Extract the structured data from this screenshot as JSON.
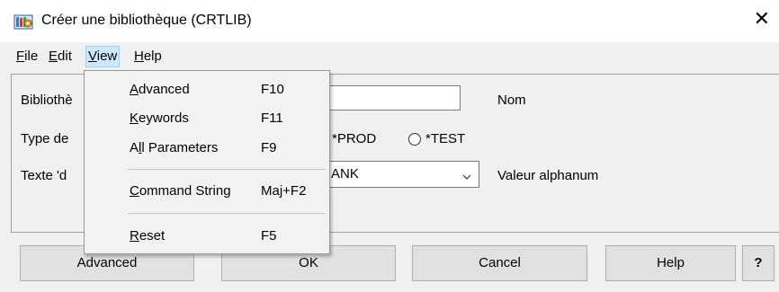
{
  "window": {
    "title": "Créer une bibliothèque (CRTLIB)",
    "close_glyph": "✕",
    "icon": "library-app-icon"
  },
  "menubar": {
    "file": {
      "accel": "F",
      "rest": "ile"
    },
    "edit": {
      "accel": "E",
      "rest": "dit"
    },
    "view": {
      "accel": "V",
      "rest": "iew"
    },
    "help": {
      "accel": "H",
      "rest": "elp"
    }
  },
  "form": {
    "library_label": "Bibliothè",
    "library_value": "",
    "library_hint": "Nom",
    "type_label": "Type de",
    "type_options": [
      "*PROD",
      "*TEST"
    ],
    "text_label": "Texte 'd",
    "text_value": "ANK",
    "text_hint": "Valeur alphanum"
  },
  "buttons": {
    "advanced": "Advanced",
    "ok": "OK",
    "cancel": "Cancel",
    "help": "Help",
    "question": "?"
  },
  "view_menu": {
    "items": [
      {
        "accel": "A",
        "rest": "dvanced",
        "shortcut": "F10"
      },
      {
        "accel": "K",
        "rest": "eywords",
        "shortcut": "F11"
      },
      {
        "pre": "A",
        "accel": "l",
        "rest": "l Parameters",
        "shortcut": "F9"
      },
      {
        "accel": "C",
        "rest": "ommand String",
        "shortcut": "Maj+F2"
      },
      {
        "accel": "R",
        "rest": "eset",
        "shortcut": "F5"
      }
    ]
  },
  "colors": {
    "menu_highlight": "#cce8ff",
    "background": "#f0f0f0",
    "button": "#e1e1e1"
  }
}
